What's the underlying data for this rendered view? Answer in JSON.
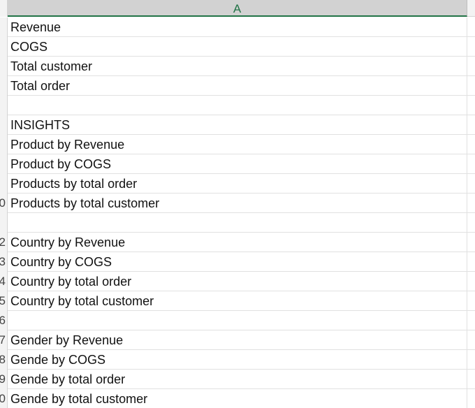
{
  "sheet": {
    "column_header": "A",
    "rows": [
      {
        "row_number": "",
        "value": "Revenue"
      },
      {
        "row_number": "",
        "value": "COGS"
      },
      {
        "row_number": "",
        "value": "Total customer"
      },
      {
        "row_number": "",
        "value": "Total order"
      },
      {
        "row_number": "",
        "value": ""
      },
      {
        "row_number": "",
        "value": "INSIGHTS"
      },
      {
        "row_number": "",
        "value": "Product by Revenue"
      },
      {
        "row_number": "",
        "value": "Product by COGS"
      },
      {
        "row_number": "",
        "value": "Products by total order"
      },
      {
        "row_number": "0",
        "value": "Products by total customer"
      },
      {
        "row_number": "",
        "value": ""
      },
      {
        "row_number": "2",
        "value": "Country by Revenue"
      },
      {
        "row_number": "3",
        "value": "Country by COGS"
      },
      {
        "row_number": "4",
        "value": "Country by total order"
      },
      {
        "row_number": "5",
        "value": "Country by total customer"
      },
      {
        "row_number": "6",
        "value": ""
      },
      {
        "row_number": "7",
        "value": "Gender by Revenue"
      },
      {
        "row_number": "8",
        "value": "Gende by COGS"
      },
      {
        "row_number": "9",
        "value": "Gende by total order"
      },
      {
        "row_number": "0",
        "value": "Gende by total customer"
      }
    ]
  }
}
